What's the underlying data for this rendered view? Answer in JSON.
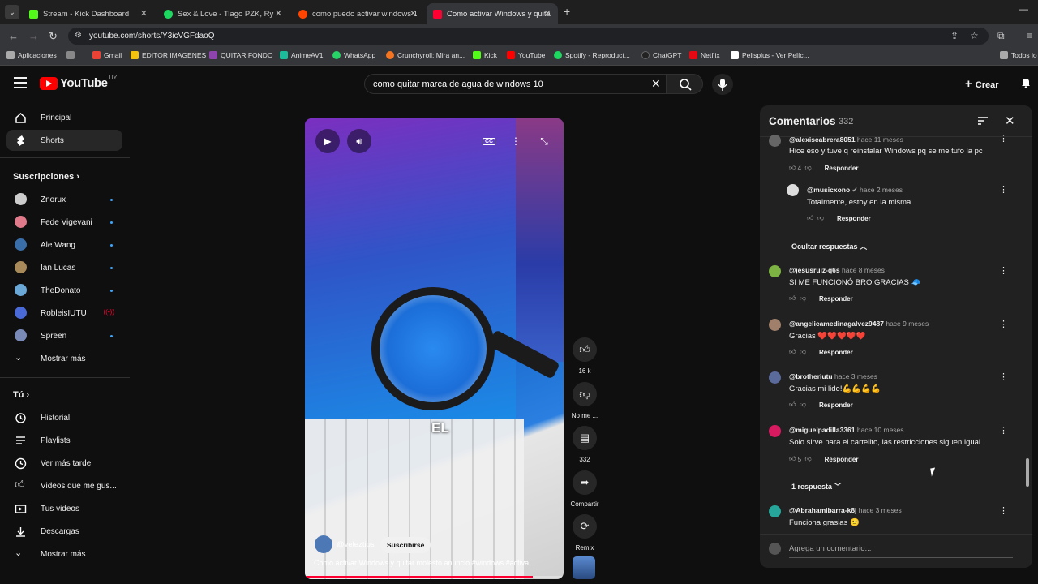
{
  "browser": {
    "tabs": [
      {
        "title": "Stream - Kick Dashboard",
        "color": "#53fc18"
      },
      {
        "title": "Sex & Love - Tiago PZK, Ry",
        "color": "#1ed760"
      },
      {
        "title": "como puedo activar windows 1",
        "color": "#ff4500"
      },
      {
        "title": "Como activar Windows y quitar",
        "color": "#ff0033"
      }
    ],
    "url": "youtube.com/shorts/Y3icVGFdaoQ",
    "bookmarks": [
      {
        "label": "Aplicaciones",
        "color": "#aaaaaa"
      },
      {
        "label": "Gmail",
        "color": "#ea4335"
      },
      {
        "label": "EDITOR IMAGENES",
        "color": "#f4c20d"
      },
      {
        "label": "QUITAR FONDO",
        "color": "#8e44ad"
      },
      {
        "label": "AnimeAV1",
        "color": "#1abc9c"
      },
      {
        "label": "WhatsApp",
        "color": "#25d366"
      },
      {
        "label": "Crunchyroll: Mira an...",
        "color": "#f47521"
      },
      {
        "label": "Kick",
        "color": "#53fc18"
      },
      {
        "label": "YouTube",
        "color": "#ff0000"
      },
      {
        "label": "Spotify - Reproduct...",
        "color": "#1ed760"
      },
      {
        "label": "ChatGPT",
        "color": "#222222"
      },
      {
        "label": "Netflix",
        "color": "#e50914"
      },
      {
        "label": "Pelisplus - Ver Pelíc...",
        "color": "#ffffff"
      },
      {
        "label": "Todos lo",
        "color": "#aaaaaa"
      }
    ]
  },
  "youtube": {
    "logo_text": "YouTube",
    "region": "UY",
    "search_query": "como quitar marca de agua de windows 10",
    "create_label": "Crear"
  },
  "sidebar": {
    "main": [
      {
        "label": "Principal",
        "icon": "home-icon"
      },
      {
        "label": "Shorts",
        "icon": "shorts-icon"
      }
    ],
    "subs_heading": "Suscripciones",
    "subscriptions": [
      {
        "label": "Znorux",
        "color": "#cccccc",
        "live": false
      },
      {
        "label": "Fede Vigevani",
        "color": "#e07a8a",
        "live": false
      },
      {
        "label": "Ale Wang",
        "color": "#3a6ea8",
        "live": false
      },
      {
        "label": "Ian Lucas",
        "color": "#a88a5a",
        "live": false
      },
      {
        "label": "TheDonato",
        "color": "#6aa8d8",
        "live": false
      },
      {
        "label": "RobleisIUTU",
        "color": "#4a6ad8",
        "live": true
      },
      {
        "label": "Spreen",
        "color": "#7a8ab8",
        "live": false
      }
    ],
    "show_more": "Mostrar más",
    "you_heading": "Tú",
    "you_items": [
      {
        "label": "Historial",
        "icon": "history-icon"
      },
      {
        "label": "Playlists",
        "icon": "playlist-icon"
      },
      {
        "label": "Ver más tarde",
        "icon": "clock-icon"
      },
      {
        "label": "Videos que me gus...",
        "icon": "thumbs-up-icon"
      },
      {
        "label": "Tus videos",
        "icon": "video-icon"
      },
      {
        "label": "Descargas",
        "icon": "download-icon"
      }
    ],
    "show_more_2": "Mostrar más"
  },
  "video": {
    "caption": "EL",
    "channel": "@veleztips",
    "subscribe": "Suscribirse",
    "title": "Como activar Windows y quitar molesto anuncio #windows #activa...",
    "progress": 0.88
  },
  "actions": {
    "likes": "16 k",
    "dislike": "No me ...",
    "comments": "332",
    "share": "Compartir",
    "remix": "Remix"
  },
  "comments": {
    "title": "Comentarios",
    "count": "332",
    "items": [
      {
        "user": "@alexiscabrera8051",
        "time": "hace 11 meses",
        "text": "Hice eso y tuve q reinstalar Windows pq se me tufo la pc",
        "likes": "4",
        "color": "#666666"
      },
      {
        "user": "@musicxono",
        "time": "hace 2 meses",
        "text": "Totalmente, estoy en la misma",
        "likes": "",
        "color": "#dddddd",
        "verified": true
      },
      {
        "user": "@jesusruiz-q6s",
        "time": "hace 8 meses",
        "text": "SI ME FUNCIONÓ BRO GRACIAS 🧢",
        "likes": "",
        "color": "#7cb342"
      },
      {
        "user": "@angelicamedinagalvez9487",
        "time": "hace 9 meses",
        "text": "Gracias ❤️❤️❤️❤️❤️",
        "likes": "",
        "color": "#a0806a"
      },
      {
        "user": "@brotheriutu",
        "time": "hace 3 meses",
        "text": "Gracias mi lide!💪💪💪💪",
        "likes": "",
        "color": "#5a6a9a"
      },
      {
        "user": "@miguelpadilla3361",
        "time": "hace 10 meses",
        "text": "Solo sirve para el cartelito, las restricciones siguen igual",
        "likes": "5",
        "color": "#d81b60"
      },
      {
        "user": "@Abrahamibarra-k8j",
        "time": "hace 3 meses",
        "text": "Funciona grasias 🙂",
        "likes": "",
        "color": "#26a69a"
      }
    ],
    "reply_label": "Responder",
    "hide_replies": "Ocultar respuestas",
    "one_reply": "1 respuesta",
    "add_placeholder": "Agrega un comentario..."
  }
}
